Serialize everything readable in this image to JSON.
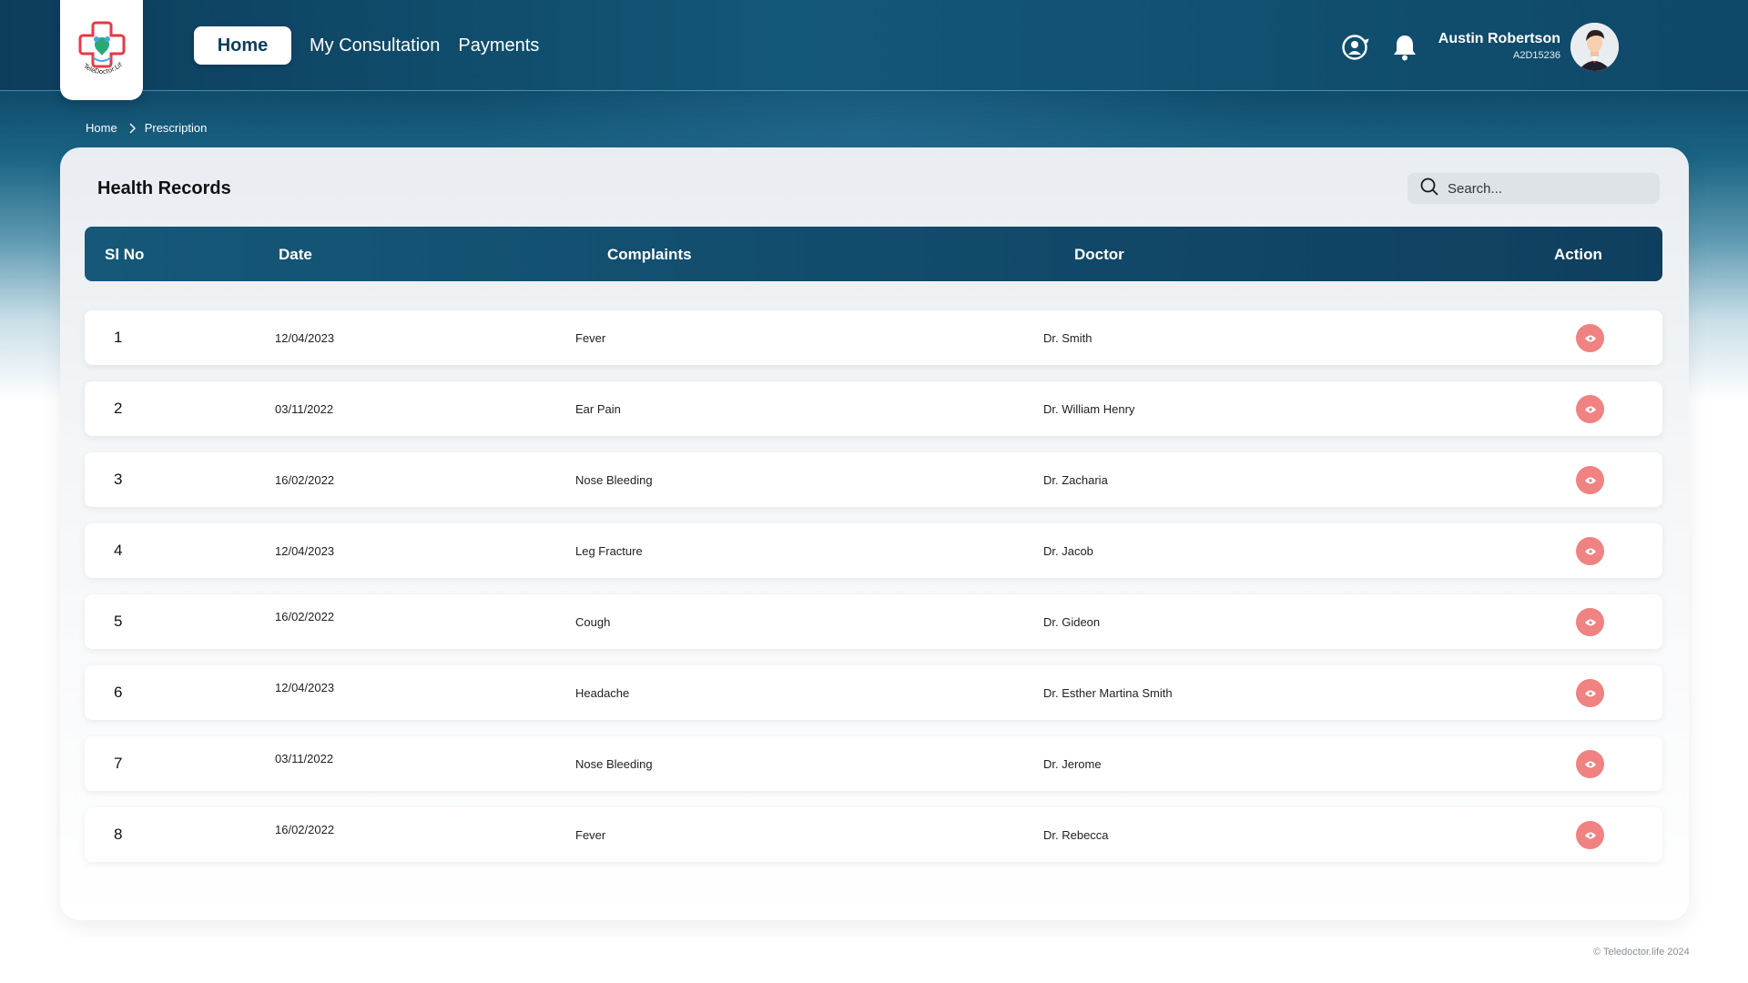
{
  "brand": {
    "logo_text": "TeleDoctor.Life",
    "accent": "#e63946"
  },
  "nav": {
    "home": "Home",
    "consultation": "My Consultation",
    "payments": "Payments"
  },
  "header_icons": [
    "support-icon",
    "bell-icon"
  ],
  "user": {
    "name": "Austin Robertson",
    "id": "A2D15236"
  },
  "breadcrumb": {
    "home": "Home",
    "current": "Prescription"
  },
  "records": {
    "title": "Health Records",
    "search_placeholder": "Search...",
    "columns": {
      "no": "Sl No",
      "date": "Date",
      "complaints": "Complaints",
      "doctor": "Doctor",
      "action": "Action"
    },
    "rows": [
      {
        "no": "1",
        "date": "12/04/2023",
        "complaint": "Fever",
        "doctor": "Dr. Smith"
      },
      {
        "no": "2",
        "date": "03/11/2022",
        "complaint": "Ear Pain",
        "doctor": "Dr. William Henry"
      },
      {
        "no": "3",
        "date": "16/02/2022",
        "complaint": "Nose Bleeding",
        "doctor": "Dr. Zacharia"
      },
      {
        "no": "4",
        "date": "12/04/2023",
        "complaint": "Leg Fracture",
        "doctor": "Dr. Jacob"
      },
      {
        "no": "5",
        "date": "16/02/2022",
        "complaint": "Cough",
        "doctor": "Dr. Gideon"
      },
      {
        "no": "6",
        "date": "12/04/2023",
        "complaint": "Headache",
        "doctor": "Dr. Esther Martina Smith"
      },
      {
        "no": "7",
        "date": "03/11/2022",
        "complaint": "Nose Bleeding",
        "doctor": "Dr. Jerome"
      },
      {
        "no": "8",
        "date": "16/02/2022",
        "complaint": "Fever",
        "doctor": "Dr. Rebecca"
      }
    ],
    "action_icon": "eye-icon",
    "action_color": "#f08282"
  },
  "footer": {
    "copyright": "© Teledoctor.life 2024"
  }
}
